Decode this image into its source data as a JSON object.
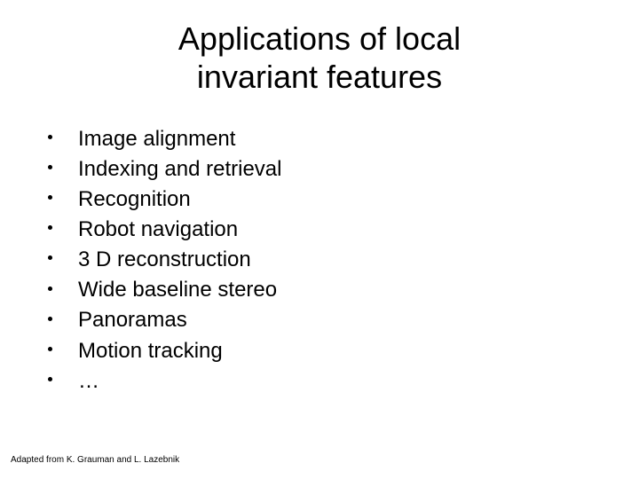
{
  "title_line1": "Applications of local",
  "title_line2": "invariant features",
  "items": [
    "Image alignment",
    "Indexing and retrieval",
    "Recognition",
    "Robot navigation",
    "3 D reconstruction",
    "Wide baseline stereo",
    "Panoramas",
    "Motion tracking",
    "…"
  ],
  "credit": "Adapted from K. Grauman and L. Lazebnik"
}
